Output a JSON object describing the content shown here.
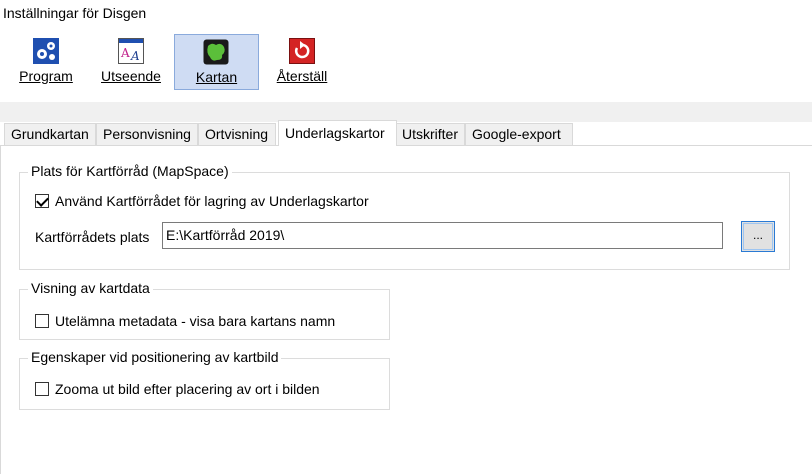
{
  "window": {
    "title": "Inställningar för Disgen"
  },
  "toolbar": {
    "buttons": [
      {
        "label": "Program",
        "icon": "gears-icon",
        "active": false
      },
      {
        "label": "Utseende",
        "icon": "font-style-icon",
        "active": false
      },
      {
        "label": "Kartan",
        "icon": "map-icon",
        "active": true
      },
      {
        "label": "Återställ",
        "icon": "reset-arrow-icon",
        "active": false
      }
    ]
  },
  "tabs": [
    "Grundkartan",
    "Personvisning",
    "Ortvisning",
    "Underlagskartor",
    "Utskrifter",
    "Google-export"
  ],
  "active_tab": "Underlagskartor",
  "mapspace": {
    "title": "Plats för Kartförråd (MapSpace)",
    "use_checkbox": {
      "label": "Använd Kartförrådet för lagring av Underlagskartor",
      "checked": true
    },
    "location_label": "Kartförrådets plats",
    "location_value": "E:\\Kartförråd 2019\\",
    "browse_label": "..."
  },
  "mapdata": {
    "title": "Visning av kartdata",
    "omit_checkbox": {
      "label": "Utelämna metadata - visa bara kartans namn",
      "checked": false
    }
  },
  "positioning": {
    "title": "Egenskaper vid positionering av kartbild",
    "zoom_checkbox": {
      "label": "Zooma ut bild efter placering av ort i bilden",
      "checked": false
    }
  },
  "colors": {
    "accent": "#2a7ad4",
    "active_toolbar_bg": "#cfdcf3",
    "tab_bg": "#f0f0f0"
  }
}
